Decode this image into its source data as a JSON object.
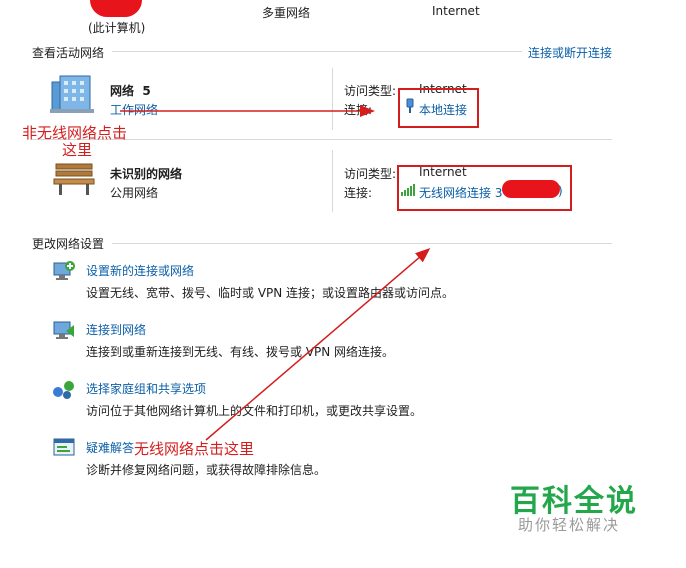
{
  "top_map": {
    "this_pc_label": "(此计算机)",
    "multi_network_label": "多重网络",
    "internet_label": "Internet"
  },
  "active_networks": {
    "header": "查看活动网络",
    "connect_disconnect_link": "连接或断开连接",
    "networks": [
      {
        "name": "网络  5",
        "type": "工作网络",
        "access_type_label": "访问类型:",
        "access_type_value": "Internet",
        "connection_label": "连接:",
        "connection_value": "本地连接",
        "icon": "building-network-icon"
      },
      {
        "name": "未识别的网络",
        "type": "公用网络",
        "access_type_label": "访问类型:",
        "access_type_value": "Internet",
        "connection_label": "连接:",
        "connection_value": "无线网络连接 3",
        "connection_suffix": ")",
        "icon": "park-bench-icon"
      }
    ]
  },
  "change_settings": {
    "header": "更改网络设置",
    "items": [
      {
        "title": "设置新的连接或网络",
        "description": "设置无线、宽带、拨号、临时或 VPN 连接；或设置路由器或访问点。",
        "icon": "new-connection-icon"
      },
      {
        "title": "连接到网络",
        "description": "连接到或重新连接到无线、有线、拨号或 VPN 网络连接。",
        "icon": "connect-network-icon"
      },
      {
        "title": "选择家庭组和共享选项",
        "description": "访问位于其他网络计算机上的文件和打印机，或更改共享设置。",
        "icon": "homegroup-icon"
      },
      {
        "title": "疑难解答",
        "description": "诊断并修复网络问题，或获得故障排除信息。",
        "icon": "troubleshoot-icon"
      }
    ]
  },
  "annotations": {
    "wired_line1": "非无线网络点击",
    "wired_line2": "这里",
    "wireless": "无线网络点击这里"
  },
  "watermark": {
    "main": "百科全说",
    "sub": "助你轻松解决"
  },
  "colors": {
    "link": "#0b5fa8",
    "annotation_red": "#d41e1e",
    "watermark_green": "#22a84a"
  }
}
